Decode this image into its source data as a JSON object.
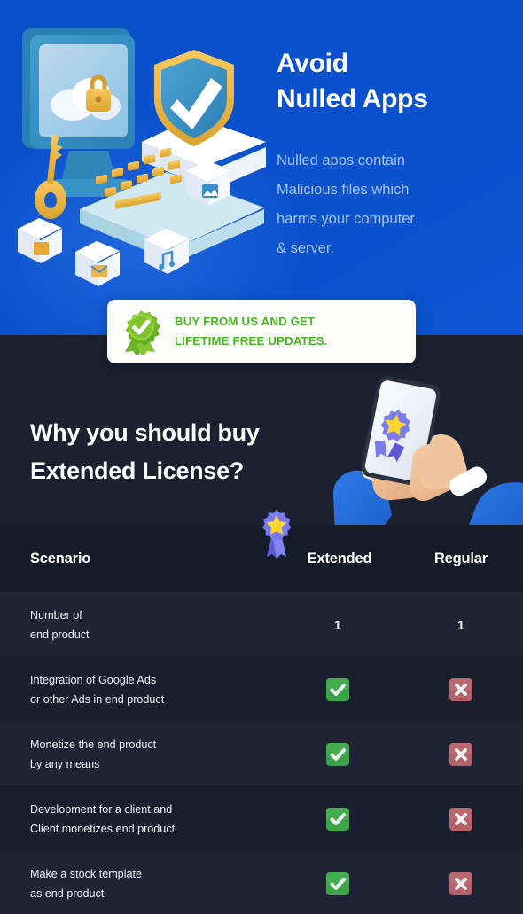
{
  "hero": {
    "title_line1": "Avoid",
    "title_line2": "Nulled Apps",
    "sub_line1": "Nulled apps contain",
    "sub_line2": "Malicious files which",
    "sub_line3": "harms your computer",
    "sub_line4": "& server.",
    "bg_color": "#0b51cd",
    "title_color": "#ffffff",
    "sub_color": "#a8c4ef",
    "illustration": "3d-security-isometric-illustration"
  },
  "buy_card": {
    "icon": "green-rosette-check-badge",
    "line1": "BUY FROM US AND GET",
    "line2": "LIFETIME FREE UPDATES.",
    "text_color": "#49b523",
    "bg_color": "#fbfbf9"
  },
  "why_section": {
    "heading_line1": "Why you should buy",
    "heading_line2": "Extended License?",
    "bg_color": "#1b2130",
    "illustration": "3d-hands-holding-phone-with-badge"
  },
  "table": {
    "ribbon_icon": "star-award-ribbon-icon",
    "headers": {
      "scenario": "Scenario",
      "extended": "Extended",
      "regular": "Regular"
    },
    "rows": [
      {
        "label_line1": "Number of",
        "label_line2": "end product",
        "extended": "1",
        "regular": "1",
        "type": "text"
      },
      {
        "label_line1": "Integration of Google Ads",
        "label_line2": "or other Ads in end product",
        "extended": "check",
        "regular": "cross",
        "type": "mark"
      },
      {
        "label_line1": "Monetize the end product",
        "label_line2": "by any means",
        "extended": "check",
        "regular": "cross",
        "type": "mark"
      },
      {
        "label_line1": "Development for a client and",
        "label_line2": "Client monetizes end product",
        "extended": "check",
        "regular": "cross",
        "type": "mark"
      },
      {
        "label_line1": "Make a stock template",
        "label_line2": "as end product",
        "extended": "check",
        "regular": "cross",
        "type": "mark"
      }
    ],
    "check_color": "#3aa447",
    "cross_color": "#b5606b",
    "header_bg": "#161b28",
    "row_bg_a": "#1e2433",
    "row_bg_b": "#191f2c"
  }
}
